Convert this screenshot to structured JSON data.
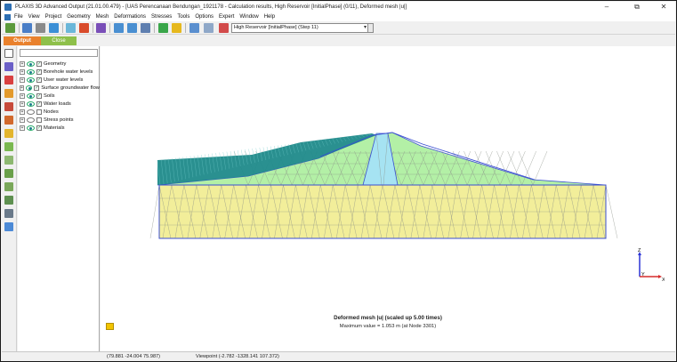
{
  "window": {
    "title": "PLAXIS 3D Advanced Output (21.01.00.479) - [UAS Perencanaan Bendungan_1921178 - Calculation results, High Reservoir [InitialPhase] (0/11), Deformed mesh |u|]",
    "controls": {
      "minimize": "–",
      "restore": "⧉",
      "close": "✕"
    }
  },
  "menu": [
    "File",
    "View",
    "Project",
    "Geometry",
    "Mesh",
    "Deformations",
    "Stresses",
    "Tools",
    "Options",
    "Expert",
    "Window",
    "Help"
  ],
  "toolbar": {
    "phase_value": "High Reservoir [InitialPhase] (Step 11)",
    "icons": [
      "open-project-icon",
      "save-icon",
      "print-icon",
      "export-image-icon",
      "colour-icon",
      "camera-icon",
      "zoom-in-icon",
      "zoom-out-icon",
      "zoom-reset-icon",
      "add-icon",
      "light-icon",
      "chart-icon",
      "table-icon"
    ]
  },
  "tabs": {
    "output": "Output",
    "close": "Close"
  },
  "explorer": {
    "items": [
      {
        "label": "Geometry",
        "visible": true
      },
      {
        "label": "Borehole water levels",
        "visible": true
      },
      {
        "label": "User water levels",
        "visible": true
      },
      {
        "label": "Surface groundwater flow",
        "visible": true
      },
      {
        "label": "Soils",
        "visible": true
      },
      {
        "label": "Water loads",
        "visible": true
      },
      {
        "label": "Nodes",
        "visible": false
      },
      {
        "label": "Stress points",
        "visible": false
      },
      {
        "label": "Materials",
        "visible": true
      }
    ]
  },
  "viewport": {
    "caption_title": "Deformed mesh |u| (scaled up 5.00 times)",
    "caption_max": "Maximum value = 1.053 m (at Node 3301)",
    "axis": {
      "x": "X",
      "y": "Y",
      "z": "Z"
    },
    "colors": {
      "foundation": "#f2ee9a",
      "embankment": "#b3f0a6",
      "core": "#a6e3f2",
      "water": "#1f8a8a",
      "mesh_outline": "#3b4fd1",
      "mesh_line": "#8a8f86"
    }
  },
  "status": {
    "cursor": "(79.881 -24.004 75.987)",
    "viewpoint": "Viewpoint (-2.782 -1328.141 107.372)"
  }
}
